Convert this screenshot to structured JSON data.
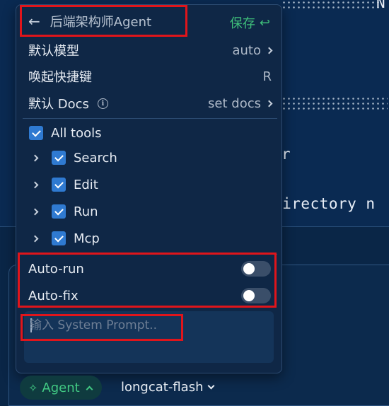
{
  "terminal": {
    "line_text": "directory n",
    "line_text_top": "N",
    "line_text_mid": "r"
  },
  "panel": {
    "header": {
      "title": "后端架构师Agent",
      "save_label": "保存"
    },
    "settings": [
      {
        "label": "默认模型",
        "value": "auto"
      },
      {
        "label": "唤起快捷键",
        "value": "R"
      },
      {
        "label": "默认 Docs",
        "value": "set docs"
      }
    ],
    "tools": {
      "all_label": "All tools",
      "items": [
        {
          "label": "Search"
        },
        {
          "label": "Edit"
        },
        {
          "label": "Run"
        },
        {
          "label": "Mcp"
        }
      ]
    },
    "toggles": [
      {
        "label": "Auto-run"
      },
      {
        "label": "Auto-fix"
      }
    ],
    "system_prompt": {
      "placeholder": "输入 System Prompt..",
      "value": ""
    }
  },
  "bottom_bar": {
    "agent_label": "Agent",
    "model_label": "longcat-flash"
  },
  "colors": {
    "accent_green": "#3fbf7a",
    "checkbox_blue": "#2f7ad1",
    "highlight_red": "#e0151b",
    "panel_bg": "#0f2746"
  }
}
